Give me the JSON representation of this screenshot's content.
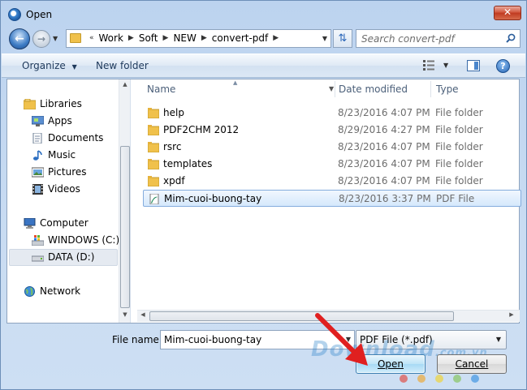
{
  "window": {
    "title": "Open",
    "close_label": "✕"
  },
  "nav": {
    "breadcrumbs": [
      "Work",
      "Soft",
      "NEW",
      "convert-pdf"
    ],
    "search_placeholder": "Search convert-pdf"
  },
  "toolbar": {
    "organize_label": "Organize",
    "new_folder_label": "New folder"
  },
  "sidebar": {
    "libraries": {
      "label": "Libraries",
      "items": [
        "Apps",
        "Documents",
        "Music",
        "Pictures",
        "Videos"
      ]
    },
    "computer": {
      "label": "Computer",
      "items": [
        "WINDOWS (C:)",
        "DATA (D:)"
      ],
      "selected": "DATA (D:)"
    },
    "network": {
      "label": "Network"
    }
  },
  "columns": {
    "name": "Name",
    "date": "Date modified",
    "type": "Type"
  },
  "files": [
    {
      "name": "help",
      "date": "8/23/2016 4:07 PM",
      "type": "File folder",
      "kind": "folder"
    },
    {
      "name": "PDF2CHM 2012",
      "date": "8/29/2016 4:27 PM",
      "type": "File folder",
      "kind": "folder"
    },
    {
      "name": "rsrc",
      "date": "8/23/2016 4:07 PM",
      "type": "File folder",
      "kind": "folder"
    },
    {
      "name": "templates",
      "date": "8/23/2016 4:07 PM",
      "type": "File folder",
      "kind": "folder"
    },
    {
      "name": "xpdf",
      "date": "8/23/2016 4:07 PM",
      "type": "File folder",
      "kind": "folder"
    },
    {
      "name": "Mim-cuoi-buong-tay",
      "date": "8/23/2016 3:37 PM",
      "type": "PDF File",
      "kind": "pdf",
      "selected": true
    }
  ],
  "bottom": {
    "file_name_label": "File name:",
    "file_name_value": "Mim-cuoi-buong-tay",
    "file_type_filter": "PDF File (*.pdf)",
    "open_label": "Open",
    "cancel_label": "Cancel"
  },
  "watermark": {
    "text": "Download",
    "suffix": ".com.vn"
  },
  "colors": {
    "accent": "#3c7fb1",
    "selection": "#d5e8fc",
    "annotation_arrow": "#e02020",
    "folder": "#f0c14b"
  }
}
